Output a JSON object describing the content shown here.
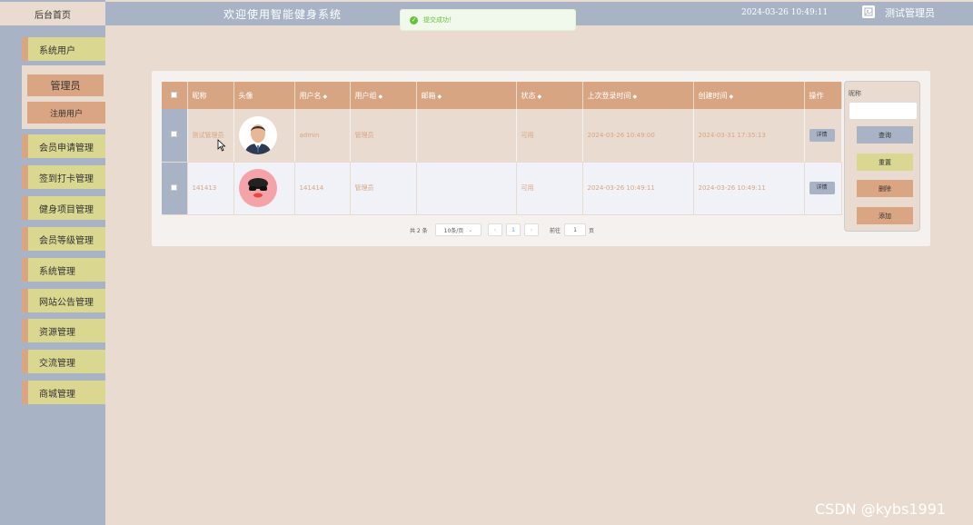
{
  "sidebar": {
    "home": "后台首页",
    "items": [
      {
        "label": "系统用户"
      },
      {
        "label": "会员申请管理"
      },
      {
        "label": "签到打卡管理"
      },
      {
        "label": "健身项目管理"
      },
      {
        "label": "会员等级管理"
      },
      {
        "label": "系统管理"
      },
      {
        "label": "网站公告管理"
      },
      {
        "label": "资源管理"
      },
      {
        "label": "交流管理"
      },
      {
        "label": "商城管理"
      }
    ],
    "group": {
      "title": "管理员",
      "sub": "注册用户"
    }
  },
  "header": {
    "title": "欢迎使用智能健身系统",
    "time": "2024-03-26 10:49:11",
    "user": "测试管理员"
  },
  "toast": {
    "message": "提交成功！"
  },
  "table": {
    "columns": [
      "昵称",
      "头像",
      "用户名",
      "用户组",
      "邮箱",
      "状态",
      "上次登录时间",
      "创建时间",
      "操作"
    ],
    "rows": [
      {
        "nickname": "测试管理员",
        "username": "admin",
        "group": "管理员",
        "email": "",
        "status": "可用",
        "last_login": "2024-03-26 10:49:00",
        "created": "2024-03-31 17:35:13",
        "action": "详情"
      },
      {
        "nickname": "141413",
        "username": "141414",
        "group": "管理员",
        "email": "",
        "status": "可用",
        "last_login": "2024-03-26 10:49:11",
        "created": "2024-03-26 10:49:11",
        "action": "详情"
      }
    ]
  },
  "search": {
    "label": "昵称",
    "query": "查询",
    "reset": "重置",
    "delete": "删除",
    "add": "添加"
  },
  "pager": {
    "total": "共 2 条",
    "size": "10条/页",
    "prev": "‹",
    "page": "1",
    "next": "›",
    "goto": "前往",
    "goto_value": "1",
    "unit": "页"
  },
  "watermark": "CSDN @kybs1991",
  "colors": {
    "sidebar": "#a8b4c6",
    "menu": "#d9d790",
    "accent": "#d9a582",
    "background": "#e9dbd0"
  }
}
